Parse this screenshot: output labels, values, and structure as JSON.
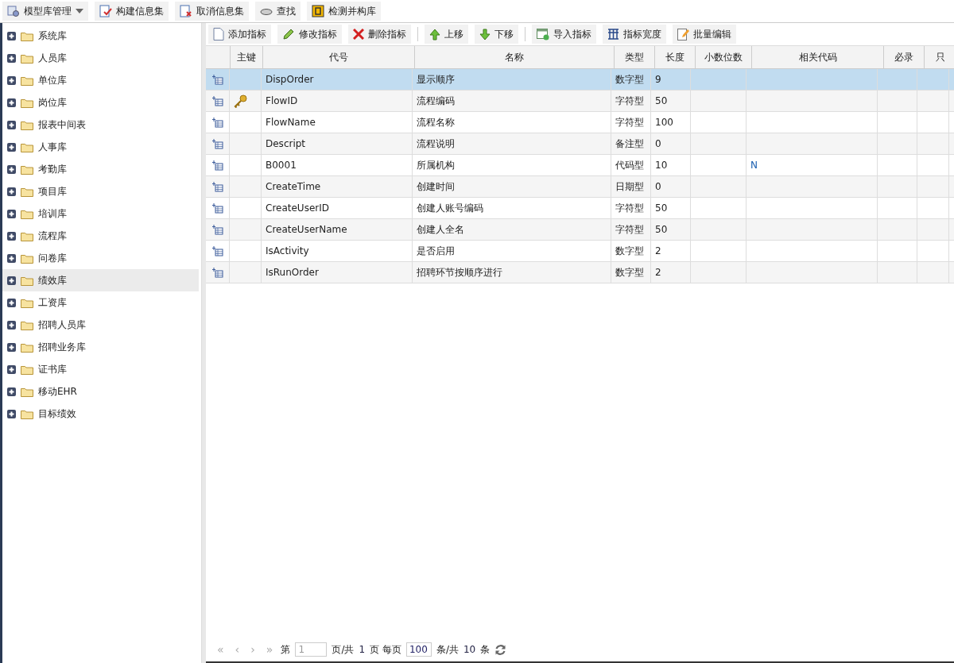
{
  "top_toolbar": [
    {
      "label": "模型库管理",
      "kind": "menu"
    },
    {
      "label": "构建信息集",
      "kind": "button"
    },
    {
      "label": "取消信息集",
      "kind": "button"
    },
    {
      "label": "查找",
      "kind": "button"
    },
    {
      "label": "检测并构库",
      "kind": "button"
    }
  ],
  "sidebar": {
    "items": [
      {
        "label": "系统库",
        "selected": false
      },
      {
        "label": "人员库",
        "selected": false
      },
      {
        "label": "单位库",
        "selected": false
      },
      {
        "label": "岗位库",
        "selected": false
      },
      {
        "label": "报表中间表",
        "selected": false
      },
      {
        "label": "人事库",
        "selected": false
      },
      {
        "label": "考勤库",
        "selected": false
      },
      {
        "label": "项目库",
        "selected": false
      },
      {
        "label": "培训库",
        "selected": false
      },
      {
        "label": "流程库",
        "selected": false
      },
      {
        "label": "问卷库",
        "selected": false
      },
      {
        "label": "绩效库",
        "selected": true
      },
      {
        "label": "工资库",
        "selected": false
      },
      {
        "label": "招聘人员库",
        "selected": false
      },
      {
        "label": "招聘业务库",
        "selected": false
      },
      {
        "label": "证书库",
        "selected": false
      },
      {
        "label": "移动EHR",
        "selected": false
      },
      {
        "label": "目标绩效",
        "selected": false
      }
    ]
  },
  "grid_toolbar": [
    {
      "label": "添加指标",
      "kind": "button"
    },
    {
      "label": "修改指标",
      "kind": "button"
    },
    {
      "label": "删除指标",
      "kind": "button"
    },
    {
      "kind": "separator"
    },
    {
      "label": "上移",
      "kind": "button"
    },
    {
      "label": "下移",
      "kind": "button"
    },
    {
      "kind": "separator"
    },
    {
      "label": "导入指标",
      "kind": "button"
    },
    {
      "label": "指标宽度",
      "kind": "button"
    },
    {
      "label": "批量编辑",
      "kind": "button"
    }
  ],
  "table": {
    "columns": [
      "主键",
      "代号",
      "名称",
      "类型",
      "长度",
      "小数位数",
      "相关代码",
      "必录",
      "只"
    ],
    "rows": [
      {
        "selected": true,
        "primary_key": false,
        "code": "DispOrder",
        "name": "显示顺序",
        "type": "数字型",
        "length": "9"
      },
      {
        "selected": false,
        "primary_key": true,
        "code": "FlowID",
        "name": "流程编码",
        "type": "字符型",
        "length": "50"
      },
      {
        "selected": false,
        "primary_key": false,
        "code": "FlowName",
        "name": "流程名称",
        "type": "字符型",
        "length": "100"
      },
      {
        "selected": false,
        "primary_key": false,
        "code": "Descript",
        "name": "流程说明",
        "type": "备注型",
        "length": "0"
      },
      {
        "selected": false,
        "primary_key": false,
        "code": "B0001",
        "name": "所属机构",
        "type": "代码型",
        "length": "10",
        "related_code": "N"
      },
      {
        "selected": false,
        "primary_key": false,
        "code": "CreateTime",
        "name": "创建时间",
        "type": "日期型",
        "length": "0"
      },
      {
        "selected": false,
        "primary_key": false,
        "code": "CreateUserID",
        "name": "创建人账号编码",
        "type": "字符型",
        "length": "50"
      },
      {
        "selected": false,
        "primary_key": false,
        "code": "CreateUserName",
        "name": "创建人全名",
        "type": "字符型",
        "length": "50"
      },
      {
        "selected": false,
        "primary_key": false,
        "code": "IsActivity",
        "name": "是否启用",
        "type": "数字型",
        "length": "2"
      },
      {
        "selected": false,
        "primary_key": false,
        "code": "IsRunOrder",
        "name": "招聘环节按顺序进行",
        "type": "数字型",
        "length": "2"
      }
    ]
  },
  "pager": {
    "first": "«",
    "prev": "‹",
    "next": "›",
    "last": "»",
    "page_prefix": "第",
    "page": "1",
    "page_suffix": "页/共",
    "pages": "1",
    "per_page_label": "页 每页",
    "per_page": "100",
    "total_prefix": "条/共",
    "total": "10",
    "total_suffix": "条"
  }
}
